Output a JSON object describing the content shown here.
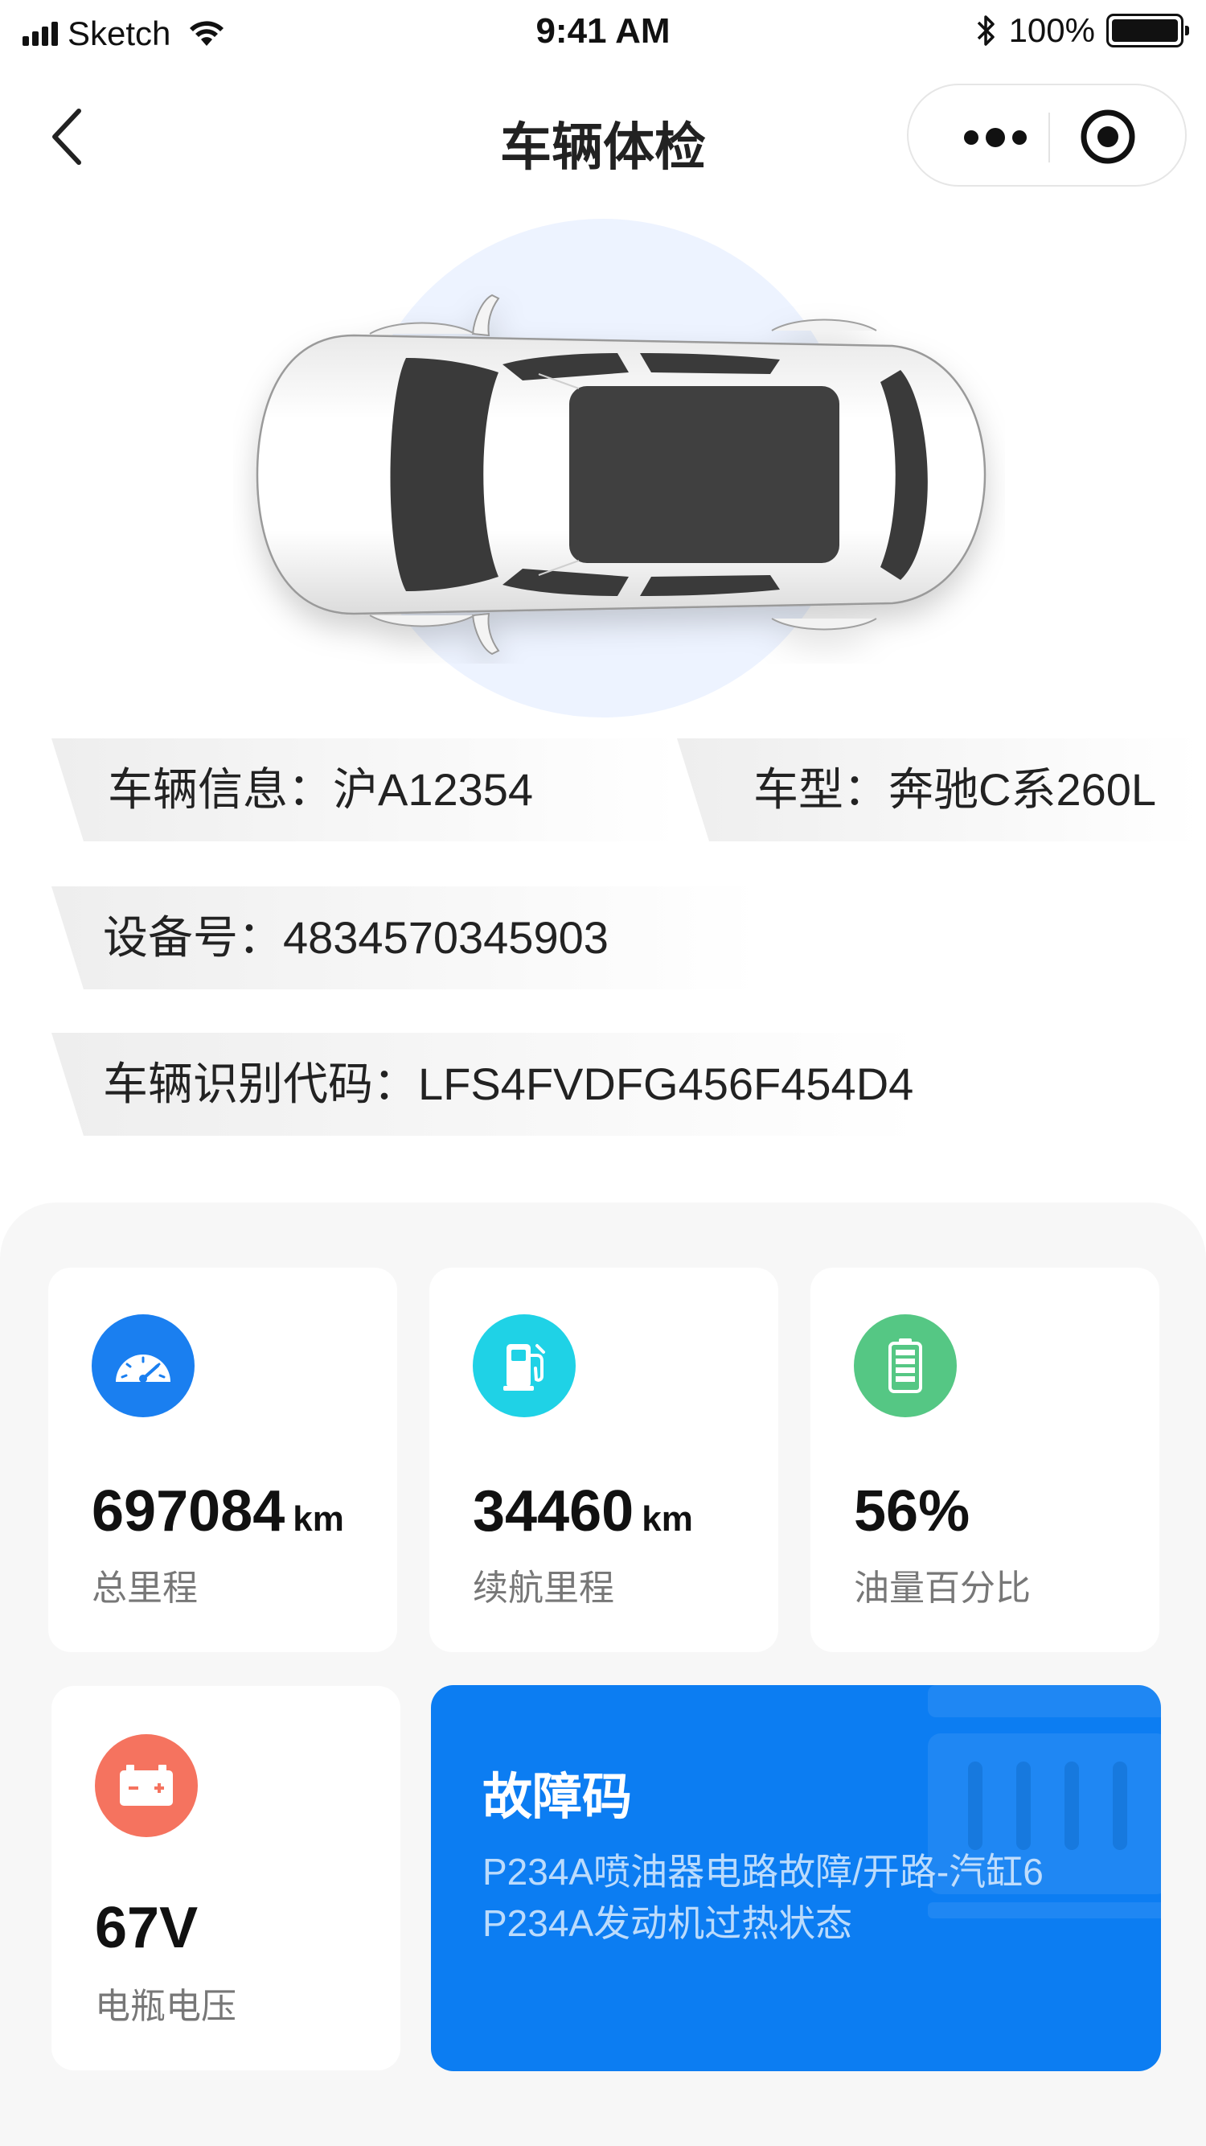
{
  "status_bar": {
    "carrier": "Sketch",
    "time": "9:41 AM",
    "battery_percent": "100%"
  },
  "nav": {
    "title": "车辆体检"
  },
  "vehicle_info": {
    "plate": "车辆信息：沪A12354",
    "model": "车型：奔驰C系260L",
    "device": "设备号：4834570345903",
    "vin": "车辆识别代码：LFS4FVDFG456F454D4"
  },
  "stats": [
    {
      "icon": "speedometer-icon",
      "color": "#1a7ff0",
      "value": "697084",
      "unit": "km",
      "label": "总里程"
    },
    {
      "icon": "fuel-pump-icon",
      "color": "#1fd2e6",
      "value": "34460",
      "unit": "km",
      "label": "续航里程"
    },
    {
      "icon": "battery-level-icon",
      "color": "#55c784",
      "value": "56%",
      "unit": "",
      "label": "油量百分比"
    },
    {
      "icon": "car-battery-icon",
      "color": "#f5735f",
      "value": "67V",
      "unit": "",
      "label": "电瓶电压"
    }
  ],
  "fault": {
    "title": "故障码",
    "lines": [
      "P234A喷油器电路故障/开路-汽缸6",
      "P234A发动机过热状态"
    ],
    "background_color": "#0c7df2"
  },
  "colors": {
    "hero_circle": "#edf3ff",
    "panel_background": "#f7f7f7"
  }
}
